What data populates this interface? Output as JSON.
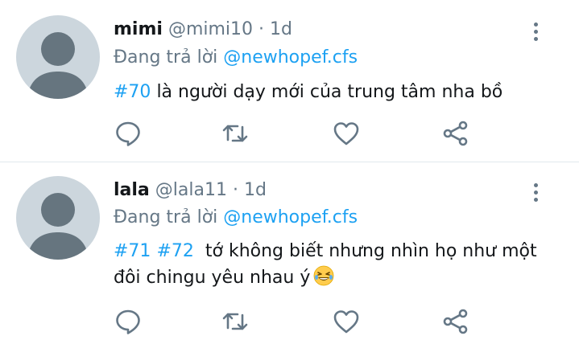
{
  "tweets": [
    {
      "display_name": "mimi",
      "handle": "@mimi10",
      "separator": "·",
      "time": "1d",
      "reply_prefix": "Đang trả lời",
      "reply_to": "@newhopef.cfs",
      "hashtags": [
        "#70"
      ],
      "text": "là người dạy mới của trung tâm nha bồ"
    },
    {
      "display_name": "lala",
      "handle": "@lala11",
      "separator": "·",
      "time": "1d",
      "reply_prefix": "Đang trả lời",
      "reply_to": "@newhopef.cfs",
      "hashtags": [
        "#71",
        "#72"
      ],
      "text": "tớ không biết nhưng nhìn họ như một đôi chingu yêu nhau ý",
      "emoji": "rolling-on-floor-laughing-emoji"
    }
  ],
  "icons": {
    "more": "more-vertical-icon",
    "reply": "reply-bubble-icon",
    "retweet": "retweet-icon",
    "like": "heart-icon",
    "share": "share-icon"
  },
  "colors": {
    "accent": "#1da1f2",
    "secondary_text": "#657786",
    "primary_text": "#14171a",
    "avatar_bg": "#ccd6dd",
    "avatar_fg": "#66757f",
    "divider": "#e1e8ed"
  }
}
